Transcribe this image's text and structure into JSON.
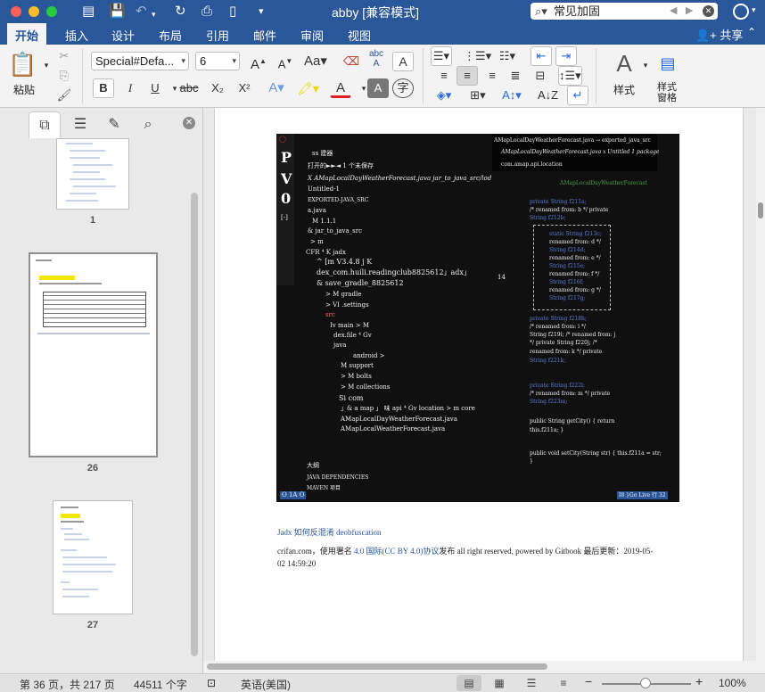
{
  "window": {
    "title": "abby [兼容模式]",
    "search_value": "常见加固"
  },
  "ribbon_tabs": [
    "开始",
    "插入",
    "设计",
    "布局",
    "引用",
    "邮件",
    "审阅",
    "视图"
  ],
  "share_label": "共享",
  "ribbon": {
    "paste_label": "粘贴",
    "font_name": "Special#Defa...",
    "font_size": "6",
    "bold": "B",
    "italic": "I",
    "underline": "U",
    "strike": "abc",
    "subscript": "X₂",
    "superscript": "X²",
    "styles_label": "样式",
    "styles_pane_label": "样式\n窗格"
  },
  "nav_pane": {
    "thumbnails": [
      {
        "page": "1"
      },
      {
        "page": "26"
      },
      {
        "page": "27"
      }
    ]
  },
  "document": {
    "image_text": {
      "title_right_1": "AMapLocalDayWeatherForecast.java → exported_java_src",
      "title_right_2": "AMapLocalDayWeatherForecast.java x  Untitled 1 package",
      "title_right_3": "com.amap.api.location",
      "left_1": "ss 建器",
      "left_2": "打开的►►◄    1 个未保存",
      "left_3": "X    AMapLocalDayWeatherForecast.java jar_to_java_src/lod",
      "left_4": "Untitled-1",
      "left_5": "EXPORTED-JAVA_SRC",
      "left_6": "a.java",
      "left_7": "M 1.1.1",
      "left_8": "& jar_to_java_src",
      "left_9": "> m",
      "left_10": "CFR ⁴ K jadx",
      "left_11": "^ [m V3.4.8 j K",
      "left_12": "dex_com.huili.readingclub8825612」adx」",
      "left_13": "& save_gradle_8825612",
      "left_14": "> M gradle",
      "left_15": "> VI .settings",
      "left_16": "src",
      "left_17": "Iv main > M",
      "left_18": "dex.file ⁴ Gv",
      "left_19": "java",
      "left_20": "android >",
      "left_21": "M support",
      "left_22": "> M bolts",
      "left_23": "> M collections",
      "left_24": "Si com",
      "left_25": "」& a map 」 味 api ⁴ Gv location > m core",
      "left_26": "AMapLocalDayWeatherForecast.java",
      "left_27": "AMapLocalWeatherForecast.java",
      "bottom_1": "大纲",
      "bottom_2": "JAVA    DEPENDENCIES",
      "bottom_3": "MAVEN 项目",
      "mid_num": "14",
      "code_head": "AMapLocalDayWeatherForecast",
      "code_1": "private String f211a;",
      "code_2": "/* renamed from: b */ private",
      "code_3": "String f212b;",
      "code_4": "static String f213c;",
      "code_5": "renamed from: d */",
      "code_6": "String f214d;",
      "code_7": "renamed from: e */",
      "code_8": "String f215e;",
      "code_9": "renamed from: f */",
      "code_10": "String f216f;",
      "code_11": "renamed from: g */",
      "code_12": "String f217g;",
      "code_13": "private String f218h;",
      "code_14": "/* renamed from: i */",
      "code_15": "String f219i; /* renamed from: j",
      "code_16": "*/ private String f220j; /*",
      "code_17": "renamed from: k */ private",
      "code_18": "String f221k;",
      "code_19": "private String f222l;",
      "code_20": "/* renamed from: m */ private",
      "code_21": "String f223m;",
      "code_22": "public String getCity() { return",
      "code_23": "this.f211a; }",
      "code_24": "public void setCity(String str) { this.f211a = str;",
      "code_25": "}",
      "status_right": "I8 }Go Live 行 32",
      "left_big_1": "P",
      "left_big_2": "V",
      "left_big_3": "0",
      "left_big_4": "[-]",
      "bottom_left": "O 1A O"
    },
    "link_text": "Jadx 如何反混淆 deobfuscation",
    "footer_pre": "crifan.com，使用署名 ",
    "footer_link": "4.0 国际(CC BY 4.0)协议",
    "footer_post": "发布 all right reserved, powered by Gitbook 最后更新：2019-05-02 14:59:20"
  },
  "status_bar": {
    "page": "第 36 页，共 217 页",
    "words": "44511 个字",
    "language": "英语(美国)",
    "zoom": "100%"
  }
}
